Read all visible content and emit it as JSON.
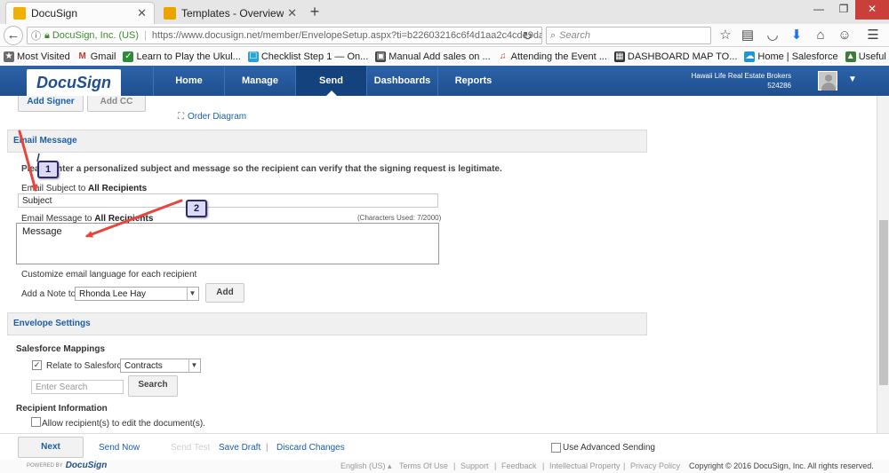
{
  "browser": {
    "tabs": [
      {
        "title": "DocuSign",
        "active": true
      },
      {
        "title": "Templates - Overview - Cl",
        "active": false
      }
    ],
    "url": {
      "org": "DocuSign, Inc. (US)",
      "address": "https://www.docusign.net/member/EnvelopeSetup.aspx?ti=b22603216c6f4d1aa2c4cde9dac57589&"
    },
    "search_placeholder": "Search",
    "bookmarks": [
      {
        "label": "Most Visited",
        "icon": "star-icon",
        "color": "#6b6b6b"
      },
      {
        "label": "Gmail",
        "icon": "gmail-icon",
        "color": "#d93025"
      },
      {
        "label": "Learn to Play the Ukul...",
        "icon": "page-icon",
        "color": "#2e8b3a"
      },
      {
        "label": "Checklist Step 1 — On...",
        "icon": "page-icon",
        "color": "#29a3d6"
      },
      {
        "label": "Manual Add sales on ...",
        "icon": "page-icon",
        "color": "#444444"
      },
      {
        "label": "Attending the Event ...",
        "icon": "page-icon",
        "color": "#c0392b"
      },
      {
        "label": "DASHBOARD MAP TO...",
        "icon": "page-icon",
        "color": "#333333"
      },
      {
        "label": "Home | Salesforce",
        "icon": "cloud-icon",
        "color": "#1b96d9"
      },
      {
        "label": "Useful Hawaiian phrases",
        "icon": "page-icon",
        "color": "#3c7d3c"
      }
    ]
  },
  "app": {
    "logo_text": "DocuSign",
    "nav": [
      "Home",
      "Manage",
      "Send",
      "Dashboards",
      "Reports"
    ],
    "active_nav": "Send",
    "account": {
      "name": "Hawaii Life Real Estate Brokers",
      "number": "524286"
    }
  },
  "recipients": {
    "add_signer": "Add Signer",
    "add_cc": "Add CC",
    "order_diagram": "Order Diagram"
  },
  "email_message": {
    "header": "Email Message",
    "instructions": "Please enter a personalized subject and message so the recipient can verify that the signing request is legitimate.",
    "subject_label": "Email Subject to ",
    "subject_label_bold": "All Recipients",
    "subject_value": "Subject",
    "message_label": "Email Message to ",
    "message_label_bold": "All Recipients",
    "char_count": "(Characters Used: 7/2000)",
    "message_value": "Message",
    "customize_link": "Customize email language for each recipient",
    "add_note_label": "Add a Note to",
    "note_recipient": "Rhonda Lee Hay",
    "add_button": "Add"
  },
  "envelope_settings": {
    "header": "Envelope Settings",
    "salesforce_mappings": "Salesforce Mappings",
    "relate_label": "Relate to Salesforce",
    "relate_value": "Contracts",
    "search_placeholder": "Enter Search",
    "search_button": "Search",
    "recipient_info": "Recipient Information",
    "allow_edit": "Allow recipient(s) to edit the document(s)."
  },
  "annotations": {
    "callout_1": "1",
    "callout_2": "2",
    "arrow_color": "#e8453c"
  },
  "actions": {
    "next": "Next",
    "send_now": "Send Now",
    "save_draft": "Save Draft",
    "discard": "Discard Changes",
    "advanced": "Use Advanced Sending"
  },
  "footer": {
    "powered_by": "POWERED BY",
    "language": "English (US) ▴",
    "terms": "Terms Of Use",
    "support": "Support",
    "feedback": "Feedback",
    "ip": "Intellectual Property",
    "privacy": "Privacy Policy",
    "copyright": "Copyright © 2016 DocuSign, Inc. All rights reserved."
  }
}
